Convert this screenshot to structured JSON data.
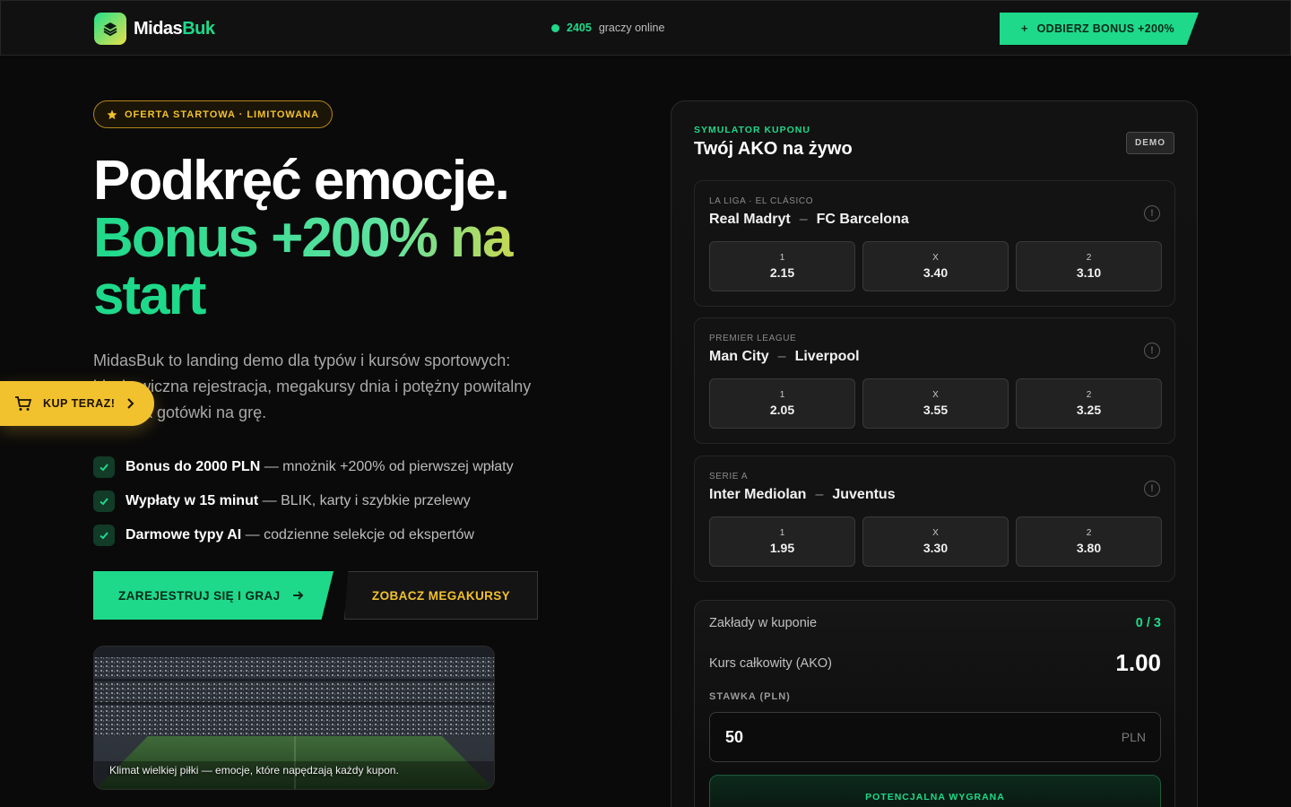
{
  "header": {
    "brand_main": "Midas",
    "brand_accent": "Buk",
    "online_count": "2405",
    "online_text": "graczy online",
    "bonus_cta_icon": "+",
    "bonus_cta": "ODBIERZ BONUS +200%"
  },
  "hero": {
    "pill": "OFERTA STARTOWA · LIMITOWANA",
    "title_line1": "Podkręć emocje.",
    "title_line2": "Bonus +200% na",
    "title_line3": "start",
    "description": "MidasBuk to landing demo dla typów i kursów sportowych: błyskawiczna rejestracja, megakursy dnia i potężny powitalny zastrzyk gotówki na grę.",
    "features": [
      {
        "bold": "Bonus do 2000 PLN",
        "rest": " — mnożnik +200% od pierwszej wpłaty"
      },
      {
        "bold": "Wypłaty w 15 minut",
        "rest": " — BLIK, karty i szybkie przelewy"
      },
      {
        "bold": "Darmowe typy AI",
        "rest": " — codzienne selekcje od ekspertów"
      }
    ],
    "btn_register": "ZAREJESTRUJ SIĘ I GRAJ",
    "btn_mega": "ZOBACZ MEGAKURSY",
    "photo_caption": "Klimat wielkiej piłki — emocje, które napędzają każdy kupon."
  },
  "floating": {
    "buy_now": "KUP TERAZ!"
  },
  "panel": {
    "kicker": "SYMULATOR KUPONU",
    "title": "Twój AKO na żywo",
    "badge": "DEMO",
    "matches": [
      {
        "league": "LA LIGA · EL CLÁSICO",
        "home": "Real Madryt",
        "sep": "–",
        "away": "FC Barcelona",
        "odds": [
          {
            "label": "1",
            "value": "2.15"
          },
          {
            "label": "X",
            "value": "3.40"
          },
          {
            "label": "2",
            "value": "3.10"
          }
        ]
      },
      {
        "league": "PREMIER LEAGUE",
        "home": "Man City",
        "sep": "–",
        "away": "Liverpool",
        "odds": [
          {
            "label": "1",
            "value": "2.05"
          },
          {
            "label": "X",
            "value": "3.55"
          },
          {
            "label": "2",
            "value": "3.25"
          }
        ]
      },
      {
        "league": "SERIE A",
        "home": "Inter Mediolan",
        "sep": "–",
        "away": "Juventus",
        "odds": [
          {
            "label": "1",
            "value": "1.95"
          },
          {
            "label": "X",
            "value": "3.30"
          },
          {
            "label": "2",
            "value": "3.80"
          }
        ]
      }
    ],
    "slip": {
      "bets_label": "Zakłady w kuponie",
      "bets_count": "0 / 3",
      "total_label": "Kurs całkowity (AKO)",
      "total_value": "1.00",
      "stake_label": "STAWKA (PLN)",
      "stake_value": "50",
      "stake_currency": "PLN",
      "win_label": "POTENCJALNA WYGRANA"
    }
  },
  "colors": {
    "accent": "#1ed98a",
    "gold": "#f2c12e",
    "background": "#0a0a0a"
  }
}
